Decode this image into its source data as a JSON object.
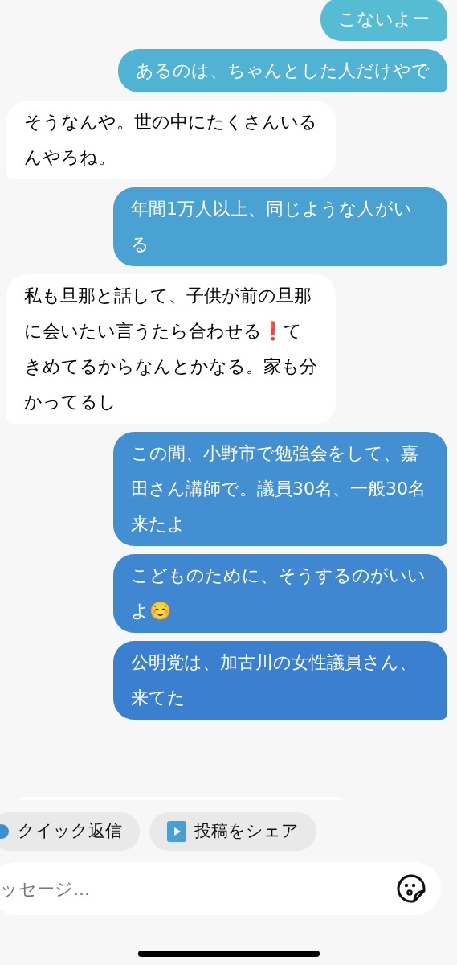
{
  "messages": [
    {
      "sent": true,
      "text": "こないよー"
    },
    {
      "sent": true,
      "text": "あるのは、ちゃんとした人だけやで"
    },
    {
      "sent": false,
      "text": "そうなんや。世の中にたくさんいるんやろね。"
    },
    {
      "sent": true,
      "text": "年間1万人以上、同じような人がいる"
    },
    {
      "sent": false,
      "text": "私も旦那と話して、子供が前の旦那に会いたい言うたら合わせる❗️てきめてるからなんとかなる。家も分かってるし"
    },
    {
      "sent": true,
      "text": "この間、小野市で勉強会をして、嘉田さん講師で。議員30名、一般30名来たよ"
    },
    {
      "sent": true,
      "text": "こどものために、そうするのがいいよ☺️"
    },
    {
      "sent": true,
      "text": "公明党は、加古川の女性議員さん、来てた"
    }
  ],
  "quick_actions": [
    {
      "kind": "reply",
      "label": "クイック返信"
    },
    {
      "kind": "share",
      "label": "投稿をシェア"
    }
  ],
  "composer": {
    "placeholder": "ッセージ..."
  }
}
